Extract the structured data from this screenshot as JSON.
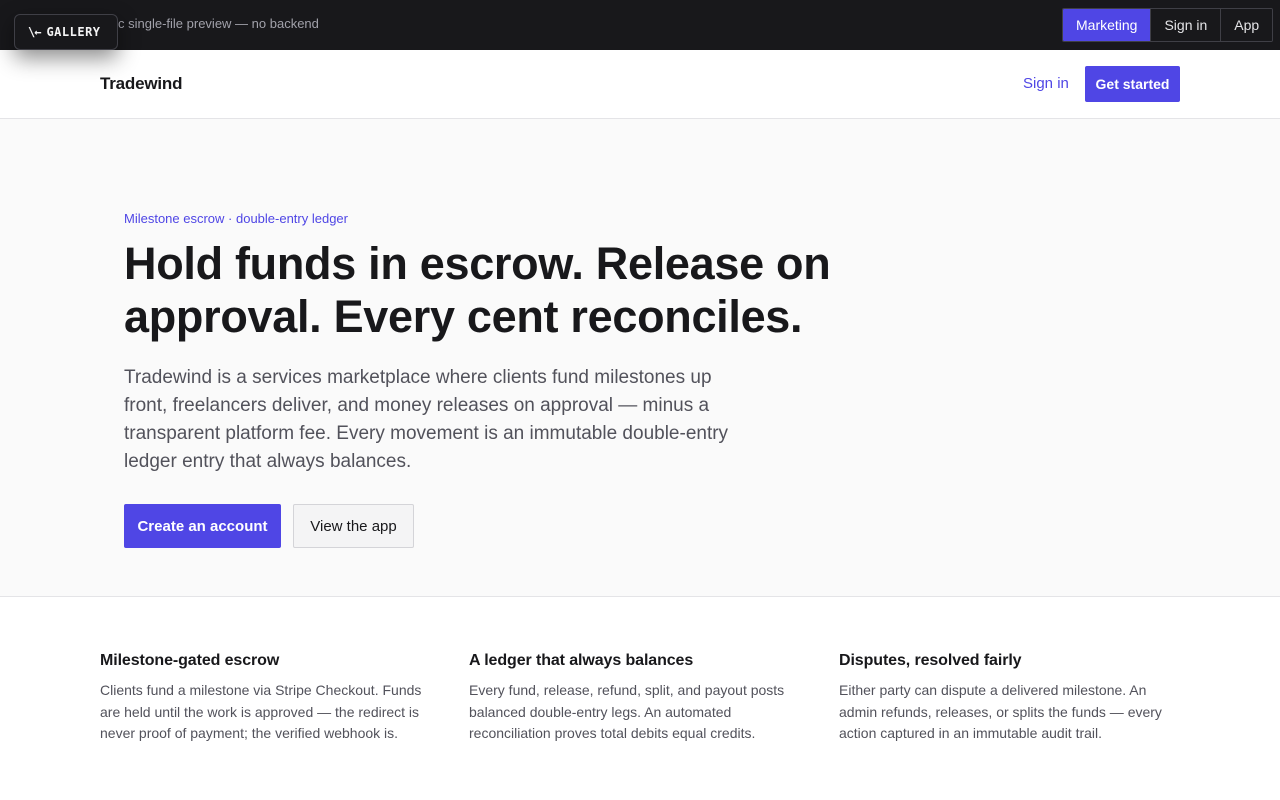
{
  "preview_bar": {
    "note": "c single-file preview — no backend",
    "gallery_button": {
      "icon": "back-arrow-icon",
      "label": "GALLERY"
    },
    "view_switcher": [
      {
        "label": "Marketing",
        "active": true
      },
      {
        "label": "Sign in",
        "active": false
      },
      {
        "label": "App",
        "active": false
      }
    ]
  },
  "header": {
    "brand": "Tradewind",
    "signin_link": "Sign in",
    "cta_button": "Get started"
  },
  "hero": {
    "eyebrow": "Milestone escrow · double-entry ledger",
    "title": "Hold funds in escrow. Release on approval. Every cent reconciles.",
    "subtitle": "Tradewind is a services marketplace where clients fund milestones up front, freelancers deliver, and money releases on approval — minus a transparent platform fee. Every movement is an immutable double-entry ledger entry that always balances.",
    "primary_button": "Create an account",
    "secondary_button": "View the app"
  },
  "features": [
    {
      "title": "Milestone-gated escrow",
      "text": "Clients fund a milestone via Stripe Checkout. Funds are held until the work is approved — the redirect is never proof of payment; the verified webhook is."
    },
    {
      "title": "A ledger that always balances",
      "text": "Every fund, release, refund, split, and payout posts balanced double-entry legs. An automated reconciliation proves total debits equal credits."
    },
    {
      "title": "Disputes, resolved fairly",
      "text": "Either party can dispute a delivered milestone. An admin refunds, releases, or splits the funds — every action captured in an immutable audit trail."
    }
  ],
  "colors": {
    "accent": "#4f46e5",
    "preview_bar_bg": "#18181b",
    "hero_bg": "#fafafa",
    "body_text": "#52525b"
  }
}
